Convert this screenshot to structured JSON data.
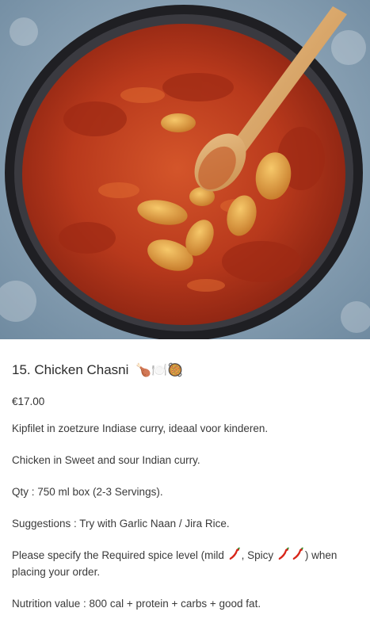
{
  "product": {
    "title": "15. Chicken Chasni",
    "title_emoji": "🍗🍽️🥘",
    "price": "€17.00",
    "description_nl": "Kipfilet in zoetzure Indiase curry, ideaal voor kinderen.",
    "description_en": "Chicken in Sweet and sour Indian curry.",
    "qty": "Qty : 750 ml box (2-3 Servings).",
    "suggestions": "Suggestions : Try with Garlic Naan / Jira Rice.",
    "spice_prefix": "Please specify the Required spice level (mild ",
    "spice_mid": ", Spicy ",
    "spice_suffix": ") when placing your order.",
    "nutrition": "Nutrition value : 800 cal + protein + carbs + good fat."
  },
  "image": {
    "subject": "chicken curry in pot with wooden spoon"
  },
  "colors": {
    "curry_red": "#b8321a",
    "sauce_orange": "#d04a22",
    "chicken_gold": "#e0a040",
    "pot_dark": "#2a2a2e",
    "background_blue": "#8aa3b8",
    "spoon_wood": "#d9a66a"
  }
}
